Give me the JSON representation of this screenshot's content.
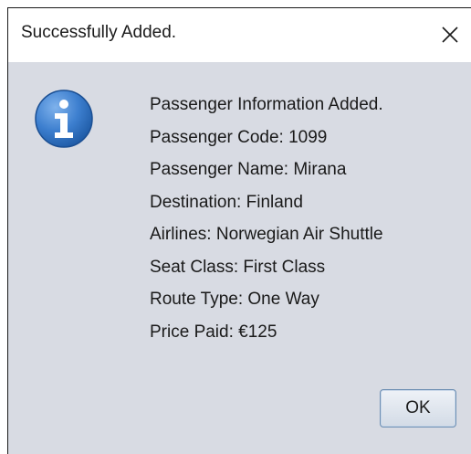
{
  "dialog": {
    "title": "Successfully Added.",
    "close_icon": "close-icon",
    "info_icon": "info-icon",
    "message_lines": [
      "Passenger Information Added.",
      "Passenger Code: 1099",
      "Passenger Name: Mirana",
      "Destination: Finland",
      "Airlines: Norwegian Air Shuttle",
      "Seat Class: First Class",
      "Route Type: One Way",
      "Price Paid: €125"
    ],
    "ok_label": "OK"
  },
  "colors": {
    "content_bg": "#d8dbe3",
    "icon_blue": "#2f6fbf",
    "button_border": "#6d8fb3"
  }
}
